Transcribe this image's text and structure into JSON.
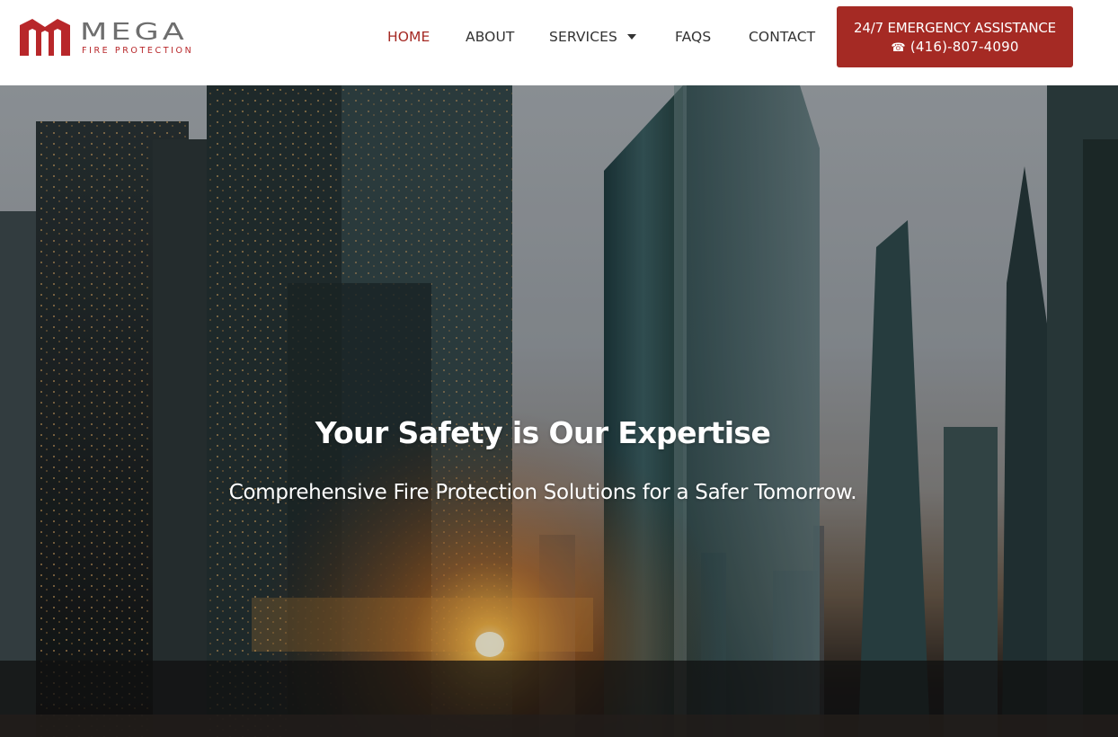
{
  "brand": {
    "name": "MEGA",
    "tagline": "FIRE PROTECTION",
    "accent": "#a52a24",
    "logo_icon": "building-m-icon"
  },
  "nav": {
    "items": [
      {
        "label": "HOME",
        "active": true
      },
      {
        "label": "ABOUT",
        "active": false
      },
      {
        "label": "SERVICES",
        "active": false,
        "has_dropdown": true
      },
      {
        "label": "FAQS",
        "active": false
      },
      {
        "label": "CONTACT",
        "active": false
      }
    ],
    "dropdown_icon": "caret-down-icon"
  },
  "emergency": {
    "title": "24/7 EMERGENCY ASSISTANCE",
    "phone_icon": "phone-icon",
    "phone": "(416)-807-4090"
  },
  "hero": {
    "title": "Your Safety is Our Expertise",
    "subtitle": "Comprehensive Fire Protection Solutions for a Safer Tomorrow."
  }
}
